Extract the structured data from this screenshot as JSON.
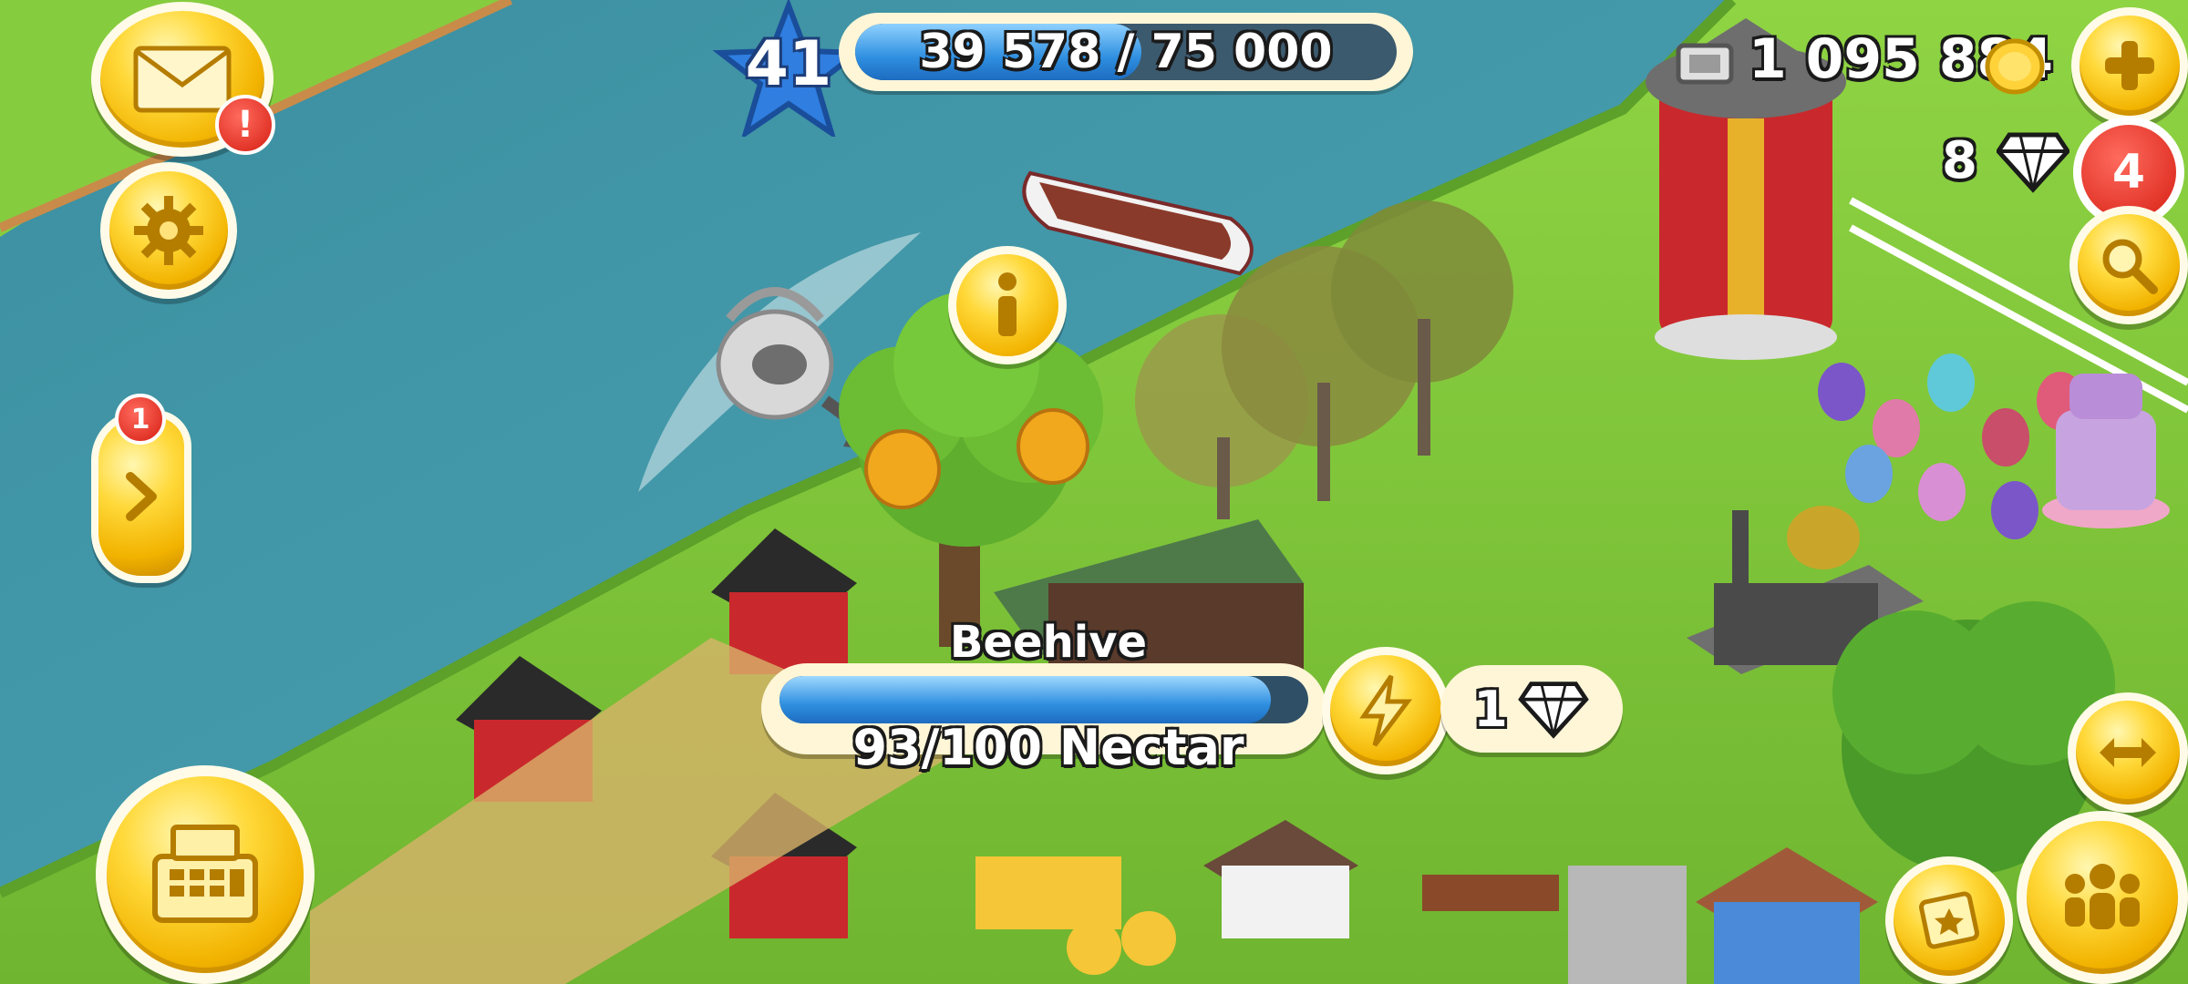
{
  "player": {
    "level": "41",
    "xp_text": "39 578 / 75 000",
    "xp_progress": 0.528
  },
  "currency": {
    "coins": "1 095 884",
    "diamonds": "8"
  },
  "badges": {
    "mail_alert": "!",
    "diamond_offers": "4",
    "side_panel": "1"
  },
  "selection": {
    "name": "Beehive",
    "status": "93/100 Nectar",
    "progress": 0.93,
    "speedup_cost": "1"
  },
  "colors": {
    "river": "#3f97a8",
    "grass": "#7cc23a",
    "gold": "#f2b300",
    "bar_blue": "#2f8fe0",
    "badge_red": "#d61e12"
  },
  "icons": {
    "mail": "envelope-icon",
    "settings": "gear-icon",
    "shop": "cash-register-icon",
    "add_coins": "plus-icon",
    "search": "magnifier-icon",
    "friends": "people-icon",
    "expand": "expand-arrows-icon",
    "speedup": "lightning-icon",
    "info": "info-icon",
    "arrow": "chevron-right-icon"
  }
}
